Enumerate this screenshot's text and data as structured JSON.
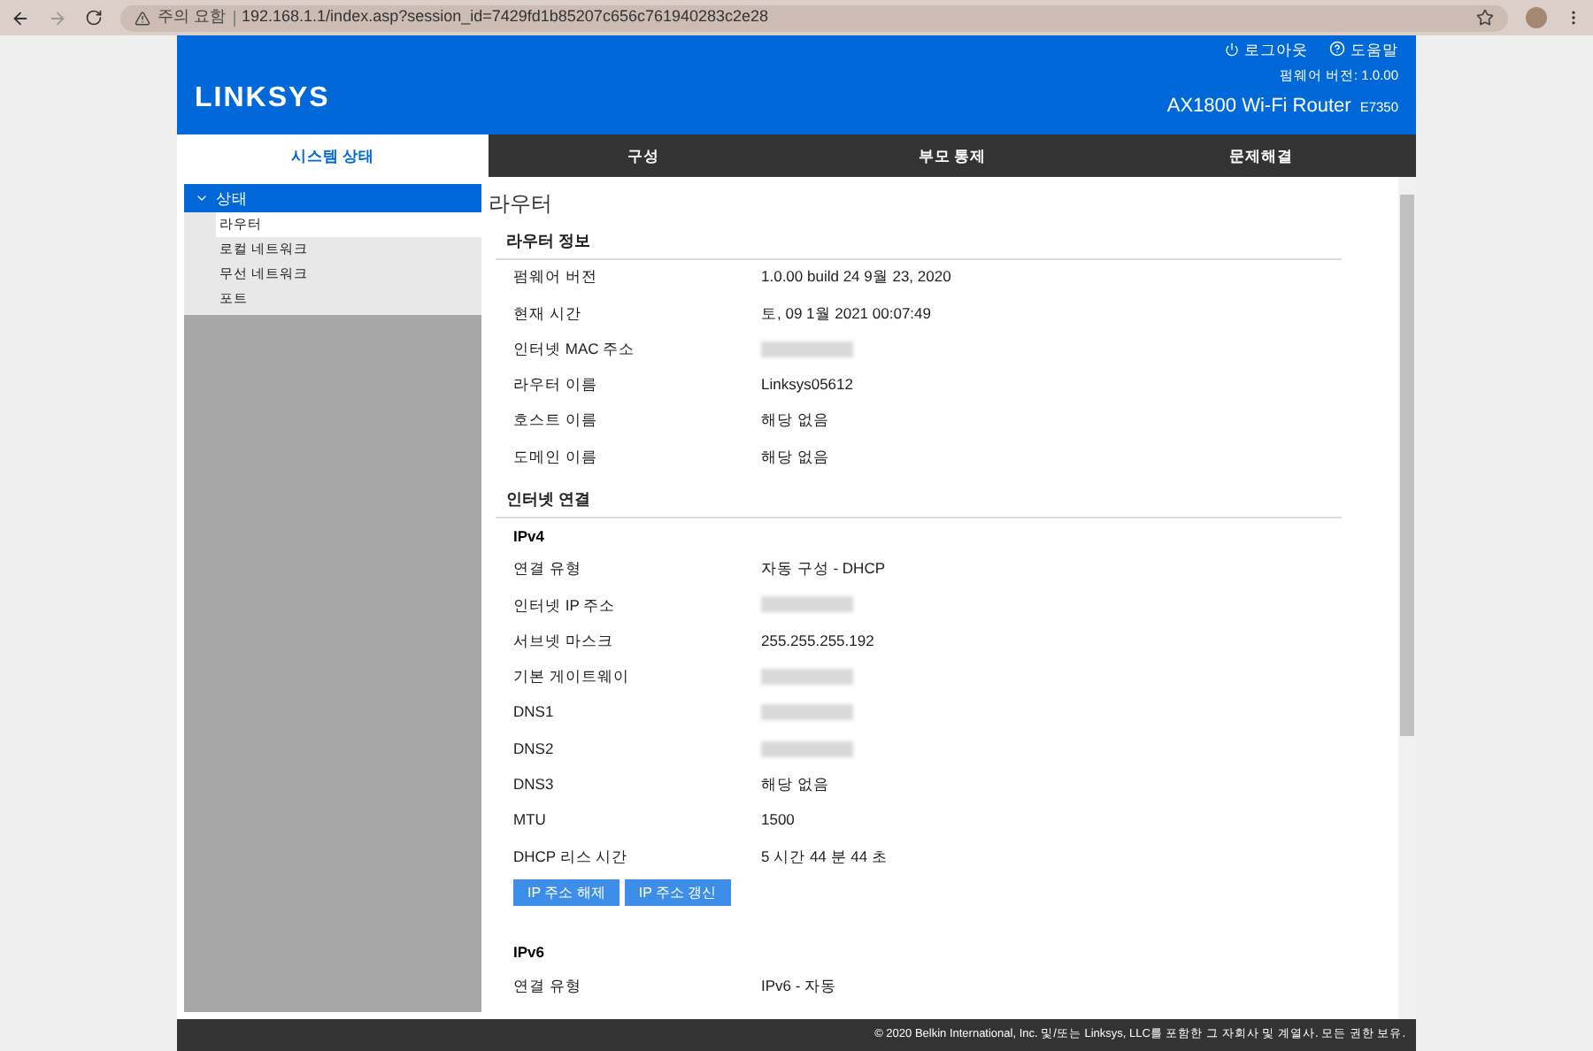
{
  "browser": {
    "security": "주의 요함",
    "url": "192.168.1.1/index.asp?session_id=7429fd1b85207c656c761940283c2e28"
  },
  "header": {
    "logo": "LINKSYS",
    "logout": "로그아웃",
    "help": "도움말",
    "firmware": "펌웨어 버전: 1.0.00",
    "model": "AX1800 Wi-Fi Router",
    "model_code": "E7350"
  },
  "tabs": [
    {
      "label": "시스템 상태",
      "selected": true
    },
    {
      "label": "구성",
      "selected": false
    },
    {
      "label": "부모 통제",
      "selected": false
    },
    {
      "label": "문제해결",
      "selected": false
    }
  ],
  "sidebar": {
    "items": [
      {
        "label": "상태",
        "expanded": true,
        "children": [
          {
            "label": "라우터",
            "selected": true
          },
          {
            "label": "로컬 네트워크",
            "selected": false
          },
          {
            "label": "무선 네트워크",
            "selected": false
          },
          {
            "label": "포트",
            "selected": false
          }
        ]
      }
    ]
  },
  "page_title": "라우터",
  "sections": [
    {
      "title": "라우터 정보",
      "groups": [
        {
          "rows": [
            {
              "label": "펌웨어 버전",
              "value": "1.0.00 build 24 9월 23, 2020"
            },
            {
              "label": "현재 시간",
              "value": "토, 09 1월 2021 00:07:49"
            },
            {
              "label": "인터넷 MAC 주소",
              "kind": "redacted"
            },
            {
              "label": "라우터 이름",
              "value": "Linksys05612"
            },
            {
              "label": "호스트 이름",
              "value": "해당 없음"
            },
            {
              "label": "도메인 이름",
              "value": "해당 없음"
            }
          ]
        }
      ]
    },
    {
      "title": "인터넷 연결",
      "groups": [
        {
          "title": "IPv4",
          "rows": [
            {
              "label": "연결 유형",
              "value": "자동 구성 - DHCP"
            },
            {
              "label": "인터넷 IP 주소",
              "kind": "redacted"
            },
            {
              "label": "서브넷 마스크",
              "value": "255.255.255.192"
            },
            {
              "label": "기본 게이트웨이",
              "kind": "redacted"
            },
            {
              "label": "DNS1",
              "kind": "redacted"
            },
            {
              "label": "DNS2",
              "kind": "redacted"
            },
            {
              "label": "DNS3",
              "value": "해당 없음"
            },
            {
              "label": "MTU",
              "value": "1500"
            },
            {
              "label": "DHCP 리스 시간",
              "value": "5 시간 44 분 44 초"
            }
          ],
          "buttons": [
            "IP 주소 해제",
            "IP 주소 갱신"
          ]
        },
        {
          "title": "IPv6",
          "rows": [
            {
              "label": "연결 유형",
              "value": "IPv6 - 자동"
            }
          ]
        }
      ]
    }
  ],
  "footer": "© 2020 Belkin International, Inc. 및/또는 Linksys, LLC를 포함한 그 자회사 및 계열사. 모든 권한 보유."
}
